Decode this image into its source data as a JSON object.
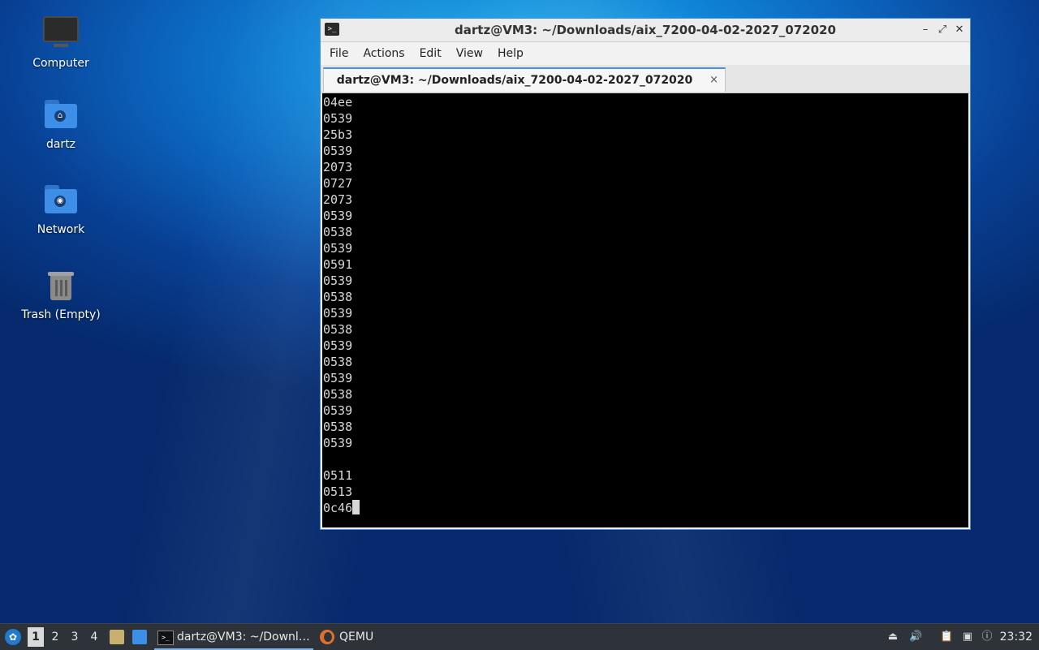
{
  "desktop": {
    "icons": [
      {
        "label": "Computer",
        "icon": "computer-icon"
      },
      {
        "label": "dartz",
        "icon": "home-folder-icon"
      },
      {
        "label": "Network",
        "icon": "network-folder-icon"
      },
      {
        "label": "Trash (Empty)",
        "icon": "trash-icon"
      }
    ]
  },
  "window": {
    "title": "dartz@VM3: ~/Downloads/aix_7200-04-02-2027_072020",
    "controls": {
      "minimize": "–",
      "maximize": "⤢",
      "close": "✕"
    },
    "menu": [
      "File",
      "Actions",
      "Edit",
      "View",
      "Help"
    ],
    "tab": {
      "title": "dartz@VM3: ~/Downloads/aix_7200-04-02-2027_072020",
      "close": "×"
    },
    "terminal_lines": [
      "04ee",
      "0539",
      "25b3",
      "0539",
      "2073",
      "0727",
      "2073",
      "0539",
      "0538",
      "0539",
      "0591",
      "0539",
      "0538",
      "0539",
      "0538",
      "0539",
      "0538",
      "0539",
      "0538",
      "0539",
      "0538",
      "0539",
      "",
      "0511",
      "0513",
      "0c46"
    ]
  },
  "taskbar": {
    "workspaces": [
      "1",
      "2",
      "3",
      "4"
    ],
    "active_workspace": "1",
    "tasks": [
      {
        "label": "dartz@VM3: ~/Downl…",
        "icon": "terminal-icon",
        "active": true
      },
      {
        "label": "QEMU",
        "icon": "qemu-icon",
        "active": false
      }
    ],
    "clock": "23:32"
  }
}
